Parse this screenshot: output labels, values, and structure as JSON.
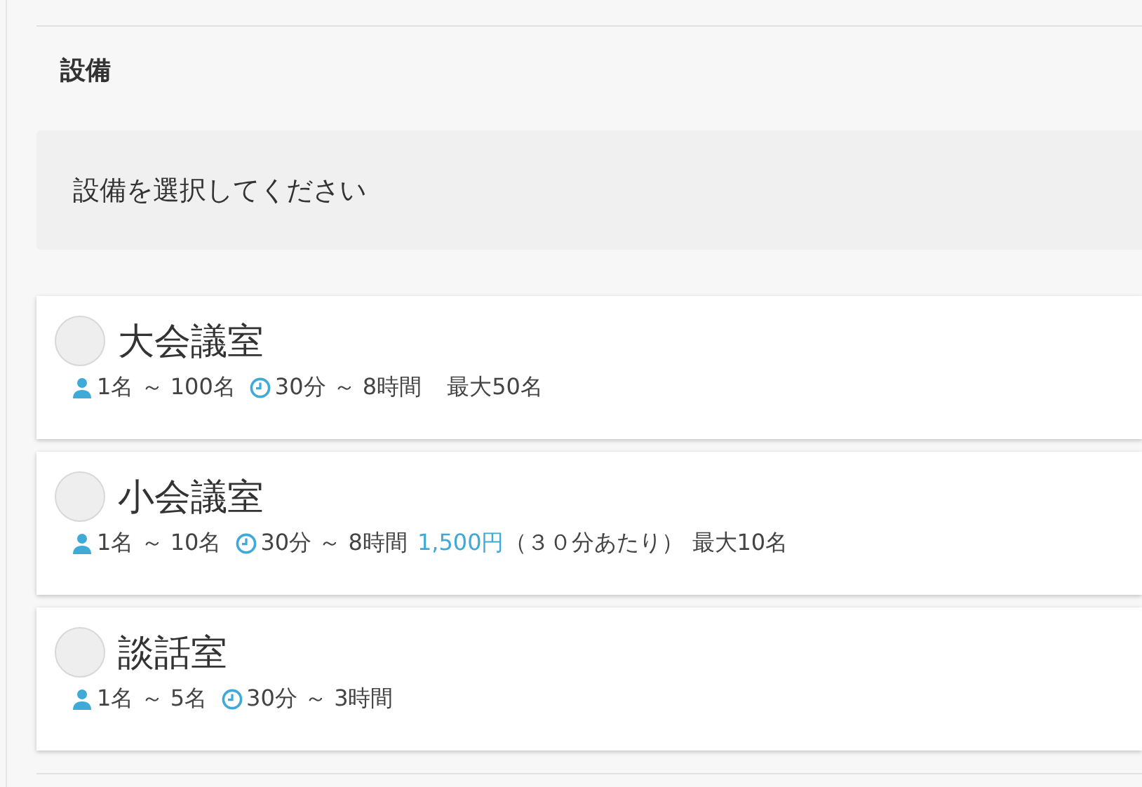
{
  "section": {
    "title": "設備"
  },
  "notice": "設備を選択してください",
  "facilities": [
    {
      "name": "大会議室",
      "selected": false,
      "capacity": "1名 ～ 100名",
      "duration": "30分 ～ 8時間",
      "max": "最大50名"
    },
    {
      "name": "小会議室",
      "selected": false,
      "capacity": "1名 ～ 10名",
      "duration": "30分 ～ 8時間",
      "price": "1,500円",
      "price_note": "（３０分あたり）",
      "max": "最大10名"
    },
    {
      "name": "談話室",
      "selected": false,
      "capacity": "1名 ～ 5名",
      "duration": "30分 ～ 3時間"
    }
  ]
}
